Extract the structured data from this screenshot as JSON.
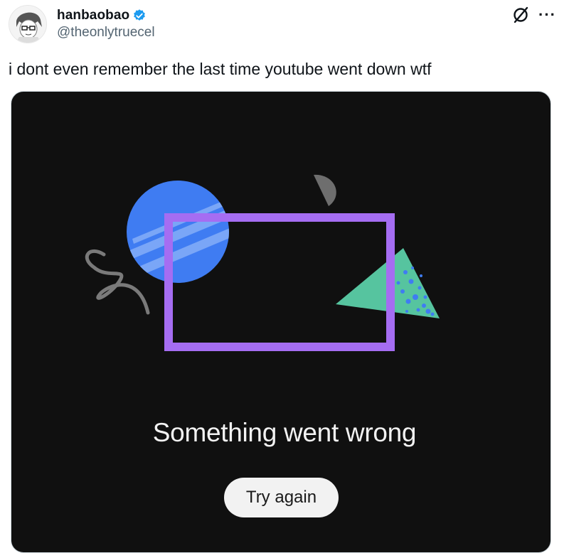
{
  "tweet": {
    "display_name": "hanbaobao",
    "handle": "@theonlytruecel",
    "text": "i dont even remember the last time youtube went down wtf"
  },
  "icons": {
    "avatar": "anime-avatar",
    "verified": "verified-badge-icon",
    "grok": "grok-icon",
    "more": "more-icon"
  },
  "media": {
    "error_message": "Something went wrong",
    "retry_label": "Try again"
  },
  "colors": {
    "verified_blue": "#1d9bf0",
    "media_background": "#101010",
    "frame_purple": "#a56df2",
    "circle_blue": "#3f7cf2",
    "triangle_green": "#56c49f",
    "button_bg": "#f2f2f2"
  }
}
